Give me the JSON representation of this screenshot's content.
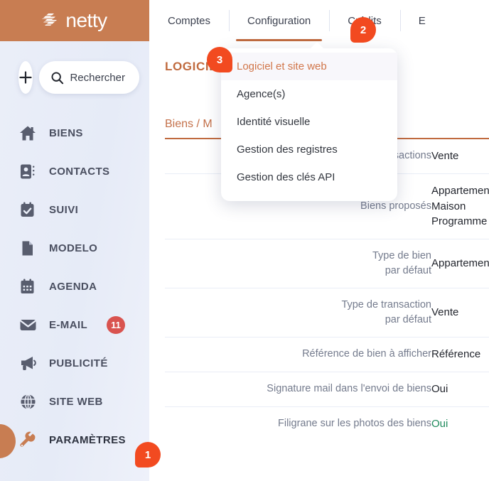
{
  "brand": {
    "name": "netty",
    "logo_icon": "netty-slashes-logo",
    "color": "#c87d52"
  },
  "sidebar": {
    "add_button": {
      "icon": "plus-icon",
      "label": "+"
    },
    "search": {
      "icon": "search-icon",
      "label": "Rechercher"
    },
    "items": [
      {
        "label": "BIENS",
        "icon": "home-icon",
        "badge": null,
        "active": false
      },
      {
        "label": "CONTACTS",
        "icon": "contacts-icon",
        "badge": null,
        "active": false
      },
      {
        "label": "SUIVI",
        "icon": "calendar-check-icon",
        "badge": null,
        "active": false
      },
      {
        "label": "MODELO",
        "icon": "document-icon",
        "badge": null,
        "active": false
      },
      {
        "label": "AGENDA",
        "icon": "calendar-grid-icon",
        "badge": null,
        "active": false
      },
      {
        "label": "E-MAIL",
        "icon": "envelope-icon",
        "badge": "11",
        "active": false
      },
      {
        "label": "PUBLICITÉ",
        "icon": "megaphone-icon",
        "badge": null,
        "active": false
      },
      {
        "label": "SITE WEB",
        "icon": "globe-icon",
        "badge": null,
        "active": false
      },
      {
        "label": "PARAMÈTRES",
        "icon": "wrench-icon",
        "badge": null,
        "active": true
      }
    ],
    "badge_color": "#d9534f"
  },
  "topbar": {
    "tabs": [
      {
        "label": "Comptes",
        "active": false
      },
      {
        "label": "Configuration",
        "active": true
      },
      {
        "label": "Crédits",
        "active": false
      },
      {
        "label": "E",
        "active": false
      }
    ],
    "active_underline_color": "#c06a3e"
  },
  "menu": {
    "items": [
      {
        "label": "Logiciel et site web",
        "current": true
      },
      {
        "label": "Agence(s)",
        "current": false
      },
      {
        "label": "Identité visuelle",
        "current": false
      },
      {
        "label": "Gestion des registres",
        "current": false
      },
      {
        "label": "Gestion des clés API",
        "current": false
      }
    ],
    "current_color": "#d1764a"
  },
  "main": {
    "page_title": "LOGICIEL",
    "breadcrumb": "Biens / M",
    "table": {
      "rows": [
        {
          "label": "Transactions",
          "value": "Vente",
          "green": false
        },
        {
          "label": "Biens proposés",
          "value": "Appartement\nMaison\nProgramme",
          "green": false
        },
        {
          "label": "Type de bien\npar défaut",
          "value": "Appartement",
          "green": false
        },
        {
          "label": "Type de transaction\npar défaut",
          "value": "Vente",
          "green": false
        },
        {
          "label": "Référence de bien à afficher",
          "value": "Référence",
          "green": false
        },
        {
          "label": "Signature mail dans l'envoi de biens",
          "value": "Oui",
          "green": false
        },
        {
          "label": "Filigrane sur les photos des biens",
          "value": "Oui",
          "green": true
        }
      ]
    }
  },
  "markers": [
    {
      "id": "1",
      "label": "1"
    },
    {
      "id": "2",
      "label": "2"
    },
    {
      "id": "3",
      "label": "3"
    }
  ]
}
